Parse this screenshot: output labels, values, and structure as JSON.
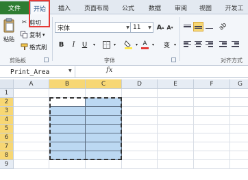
{
  "tabs": {
    "file": "文件",
    "home": "开始",
    "insert": "插入",
    "page_layout": "页面布局",
    "formulas": "公式",
    "data": "数据",
    "review": "审阅",
    "view": "视图",
    "developer": "开发工"
  },
  "clipboard": {
    "paste": "粘贴",
    "cut": "剪切",
    "copy": "复制",
    "copy_arrow": "▾",
    "format_painter": "格式刷",
    "group_label": "剪贴板"
  },
  "font": {
    "name": "宋体",
    "size": "11",
    "grow": "A",
    "shrink": "A",
    "bold": "B",
    "italic": "I",
    "underline": "U",
    "fill_color_letter": "A",
    "font_color_letter": "A",
    "phonetic": "变",
    "group_label": "字体"
  },
  "alignment": {
    "group_label": "对齐方式"
  },
  "formula_bar": {
    "name_box": "Print_Area",
    "fx": "fx"
  },
  "sheet": {
    "columns": [
      "A",
      "B",
      "C",
      "D",
      "E",
      "F",
      "G"
    ],
    "rows": [
      "1",
      "2",
      "3",
      "4",
      "5",
      "6",
      "7",
      "8",
      "9"
    ],
    "selected_columns": [
      "B",
      "C"
    ],
    "selected_rows": [
      "2",
      "3",
      "4",
      "5",
      "6",
      "7",
      "8"
    ]
  },
  "colors": {
    "accent_file_tab": "#2e7d32",
    "highlight_red": "#e53935",
    "selection_fill": "#bcd8f2",
    "header_selected": "#f7d774",
    "font_color_red": "#e53935",
    "fill_color_yellow": "#ffe84d"
  }
}
